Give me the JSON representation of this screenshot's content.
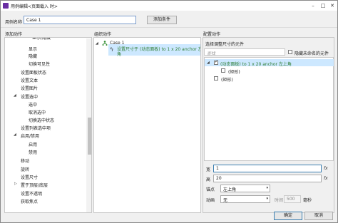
{
  "window": {
    "title": "用例编辑<页面载入 时>",
    "minimize": "–",
    "maximize": "□",
    "close": "✕"
  },
  "case_name": {
    "label": "用例名称",
    "value": "Case 1",
    "add_condition": "添加条件"
  },
  "left": {
    "header": "添加动作",
    "items": [
      "显示",
      "隐藏",
      "切换可见性",
      "设置面板状态",
      "设置文本",
      "设置图片",
      "设置选中",
      "选中",
      "取消选中",
      "切换选中状态",
      "设置列表选中项",
      "启用/禁用",
      "启用",
      "禁用",
      "移动",
      "旋转",
      "设置尺寸",
      "置于顶层/底层",
      "设置不透明",
      "获取焦点"
    ]
  },
  "middle": {
    "header": "组织动作",
    "case": "Case 1",
    "action_line1": "设置尺寸于 (动态面板) to 1 x 20 anchor 左上角",
    "action_line2": "角"
  },
  "right": {
    "header": "配置动作",
    "subheader": "选择调整尺寸的元件",
    "search_placeholder": "查找",
    "hide_unnamed": "隐藏未命名的元件",
    "tree": [
      {
        "label": "(动态面板) to 1 x 20 anchor 左上角",
        "checked": true
      },
      {
        "label": "(矩形)",
        "checked": false
      },
      {
        "label": "(矩形)",
        "checked": false
      }
    ],
    "width_label": "宽",
    "width_value": "1",
    "height_label": "高",
    "height_value": "20",
    "anchor_label": "锚点",
    "anchor_value": "左上角",
    "anim_label": "动画",
    "anim_value": "无",
    "time_label": "时间",
    "time_value": "500",
    "ms_label": "毫秒",
    "fx": "fx"
  },
  "footer": {
    "ok": "确定",
    "cancel": "取消"
  },
  "colors": {
    "selection": "#cde8ff",
    "focus_border": "#3c7fb1",
    "action_text": "#2e7d32",
    "app_icon": "#6a2fa3"
  }
}
